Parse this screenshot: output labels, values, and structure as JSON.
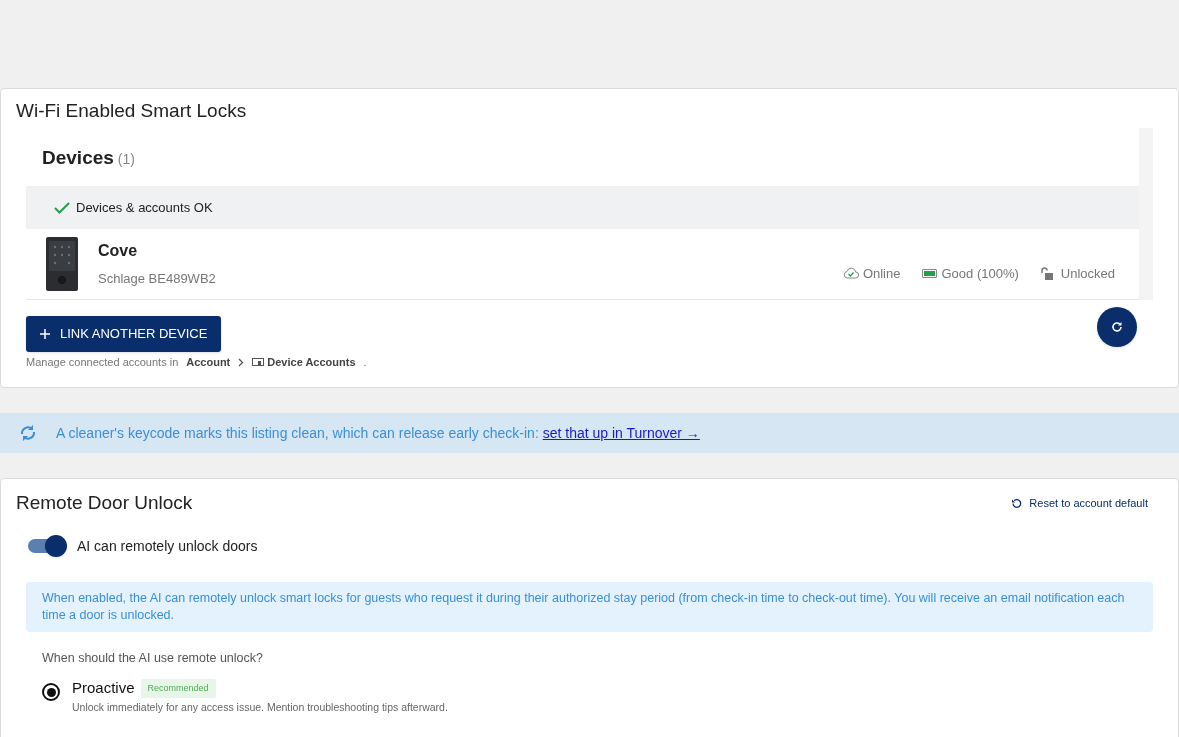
{
  "locks_card": {
    "title": "Wi-Fi Enabled Smart Locks",
    "devices_heading": "Devices",
    "devices_count": "(1)",
    "status_message": "Devices & accounts OK",
    "devices": [
      {
        "name": "Cove",
        "model": "Schlage BE489WB2",
        "connection": "Online",
        "battery": "Good (100%)",
        "lock_state": "Unlocked",
        "locked": false
      }
    ],
    "link_button": "LINK ANOTHER DEVICE",
    "manage_text": "Manage connected accounts in",
    "breadcrumb": [
      "Account",
      "Device Accounts"
    ],
    "breadcrumb_end": "."
  },
  "turnover_banner": {
    "text": "A cleaner's keycode marks this listing clean, which can release early check-in:",
    "link": "set that up in Turnover →"
  },
  "remote_unlock": {
    "title": "Remote Door Unlock",
    "reset_link": "Reset to account default",
    "toggle_label": "AI can remotely unlock doors",
    "toggle_on": true,
    "info": "When enabled, the AI can remotely unlock smart locks for guests who request it during their authorized stay period (from check-in time to check-out time). You will receive an email notification each time a door is unlocked.",
    "question": "When should the AI use remote unlock?",
    "options": [
      {
        "label": "Proactive",
        "badge": "Recommended",
        "description": "Unlock immediately for any access issue. Mention troubleshooting tips afterward.",
        "selected": true
      }
    ]
  }
}
